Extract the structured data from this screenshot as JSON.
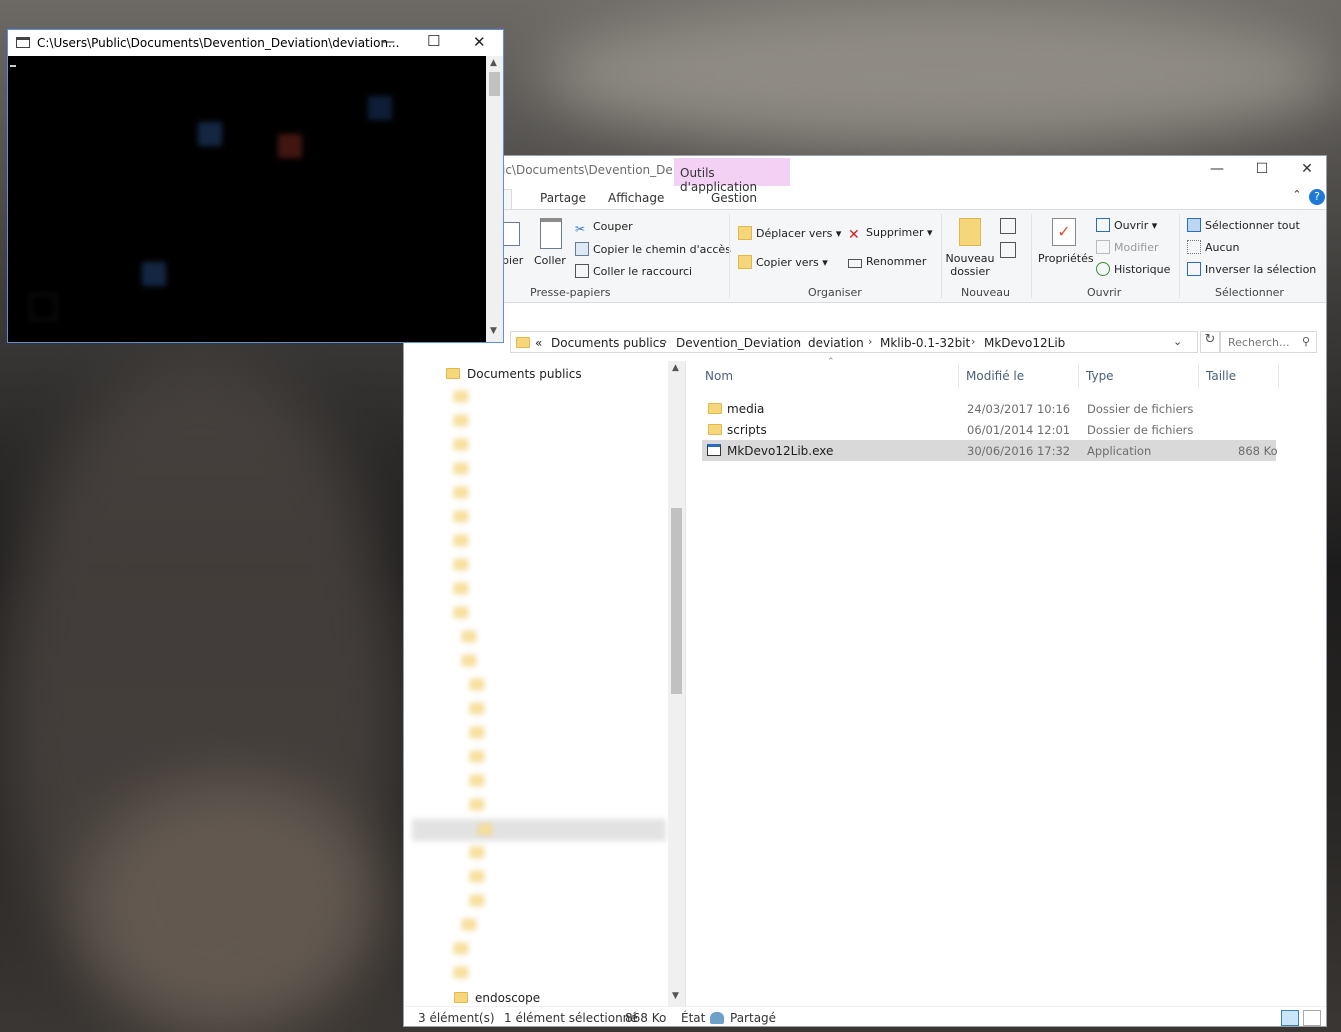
{
  "console": {
    "title": "C:\\Users\\Public\\Documents\\Devention_Deviation\\deviation..."
  },
  "explorer": {
    "title_path": "ic\\Documents\\Devention_De...",
    "tools_tab": "Outils d'application",
    "tabs": [
      "il",
      "Partage",
      "Affichage",
      "Gestion"
    ],
    "ribbon": {
      "clipboard": {
        "copy": "pier",
        "paste": "Coller",
        "cut": "Couper",
        "copy_path": "Copier le chemin d'accès",
        "paste_shortcut": "Coller le raccourci",
        "label": "Presse-papiers"
      },
      "organize": {
        "move_to": "Déplacer vers",
        "copy_to": "Copier vers",
        "delete": "Supprimer",
        "rename": "Renommer",
        "label": "Organiser"
      },
      "new": {
        "new_folder": "Nouveau dossier",
        "label": "Nouveau"
      },
      "open": {
        "properties": "Propriétés",
        "open": "Ouvrir",
        "edit": "Modifier",
        "history": "Historique",
        "label": "Ouvrir"
      },
      "select": {
        "select_all": "Sélectionner tout",
        "select_none": "Aucun",
        "invert": "Inverser la sélection",
        "label": "Sélectionner"
      }
    },
    "address": {
      "overflow": "«",
      "crumbs": [
        "Documents publics",
        "Devention_Deviation",
        "deviation",
        "Mklib-0.1-32bit",
        "MkDevo12Lib"
      ],
      "search_placeholder": "Recherch..."
    },
    "nav": {
      "top_item": "Documents publics",
      "bottom_item": "endoscope"
    },
    "columns": [
      "Nom",
      "Modifié le",
      "Type",
      "Taille"
    ],
    "files": [
      {
        "name": "media",
        "modified": "24/03/2017 10:16",
        "type": "Dossier de fichiers",
        "size": "",
        "icon": "folder-icon"
      },
      {
        "name": "scripts",
        "modified": "06/01/2014 12:01",
        "type": "Dossier de fichiers",
        "size": "",
        "icon": "folder-icon"
      },
      {
        "name": "MkDevo12Lib.exe",
        "modified": "30/06/2016 17:32",
        "type": "Application",
        "size": "868 Ko",
        "icon": "application-icon"
      }
    ],
    "status": {
      "count": "3 élément(s)",
      "selection": "1 élément sélectionné",
      "size": "868 Ko",
      "state_label": "État :",
      "state_value": "Partagé"
    }
  }
}
